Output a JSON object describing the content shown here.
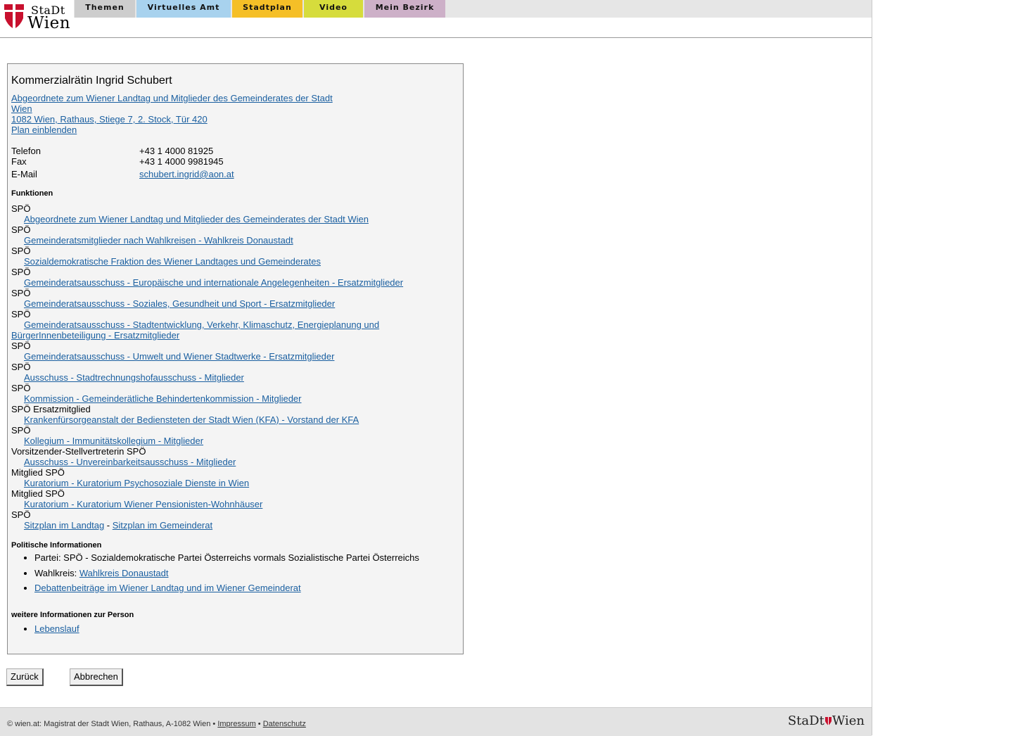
{
  "header": {
    "logo_line1": "StaDt",
    "logo_line2": "Wien",
    "nav": [
      {
        "label": "Themen",
        "color": "#cdcdcd"
      },
      {
        "label": "Virtuelles Amt",
        "color": "#a8d2ee"
      },
      {
        "label": "Stadtplan",
        "color": "#f5bf27"
      },
      {
        "label": "Video",
        "color": "#d6dc3c"
      },
      {
        "label": "Mein Bezirk",
        "color": "#cdb0c8"
      }
    ]
  },
  "person": {
    "name": "Kommerzialrätin Ingrid Schubert",
    "address_line1": "Abgeordnete zum Wiener Landtag und Mitglieder des Gemeinderates der Stadt",
    "address_line2": "Wien ",
    "address_line3": "1082 Wien, Rathaus, Stiege 7, 2. Stock, Tür 420",
    "plan_link": "Plan einblenden",
    "contact": {
      "phone_label": "Telefon",
      "phone": "+43 1 4000 81925",
      "fax_label": "Fax",
      "fax": "+43 1 4000 9981945",
      "email_label": "E-Mail",
      "email": "schubert.ingrid@aon.at"
    }
  },
  "functions": {
    "title": "Funktionen",
    "items": [
      {
        "party": "SPÖ",
        "link": "Abgeordnete zum Wiener Landtag und Mitglieder des Gemeinderates der Stadt Wien"
      },
      {
        "party": "SPÖ",
        "link": "Gemeinderatsmitglieder nach Wahlkreisen - Wahlkreis Donaustadt"
      },
      {
        "party": "SPÖ",
        "link": "Sozialdemokratische Fraktion des Wiener Landtages und Gemeinderates"
      },
      {
        "party": "SPÖ",
        "link": "Gemeinderatsausschuss - Europäische und internationale Angelegenheiten - Ersatzmitglieder"
      },
      {
        "party": "SPÖ",
        "link": "Gemeinderatsausschuss - Soziales, Gesundheit und Sport - Ersatzmitglieder"
      },
      {
        "party": "SPÖ",
        "link": "Gemeinderatsausschuss - Stadtentwicklung, Verkehr, Klimaschutz, Energieplanung und",
        "link_cont": "BürgerInnenbeteiligung - Ersatzmitglieder"
      },
      {
        "party": "SPÖ",
        "link": "Gemeinderatsausschuss - Umwelt und Wiener Stadtwerke - Ersatzmitglieder"
      },
      {
        "party": "SPÖ",
        "link": "Ausschuss - Stadtrechnungshofausschuss - Mitglieder"
      },
      {
        "party": "SPÖ",
        "link": "Kommission - Gemeinderätliche Behindertenkommission - Mitglieder"
      },
      {
        "party": "SPÖ Ersatzmitglied",
        "link": "Krankenfürsorgeanstalt der Bediensteten der Stadt Wien (KFA) - Vorstand der KFA"
      },
      {
        "party": "SPÖ",
        "link": "Kollegium - Immunitätskollegium - Mitglieder"
      },
      {
        "party": "Vorsitzender-Stellvertreterin SPÖ",
        "link": "Ausschuss - Unvereinbarkeitsausschuss - Mitglieder"
      },
      {
        "party": "Mitglied SPÖ",
        "link": "Kuratorium - Kuratorium Psychosoziale Dienste in Wien"
      },
      {
        "party": "Mitglied SPÖ",
        "link": "Kuratorium - Kuratorium Wiener Pensionisten-Wohnhäuser"
      }
    ],
    "last_party": "SPÖ",
    "seat_landtag": "Sitzplan im Landtag",
    "seat_sep": " - ",
    "seat_gemeinderat": "Sitzplan im Gemeinderat"
  },
  "political": {
    "title": "Politische Informationen",
    "party_text": "Partei: SPÖ - Sozialdemokratische Partei Österreichs vormals Sozialistische Partei Österreichs",
    "wahlkreis_label": "Wahlkreis: ",
    "wahlkreis_link": "Wahlkreis Donaustadt",
    "debates_link": "Debattenbeiträge im Wiener Landtag und im Wiener Gemeinderat"
  },
  "more": {
    "title": "weitere Informationen zur Person",
    "cv_link": "Lebenslauf"
  },
  "buttons": {
    "back": "Zurück",
    "cancel": "Abbrechen"
  },
  "footer": {
    "copyright": "© wien.at: Magistrat der Stadt Wien, Rathaus, A-1082 Wien • ",
    "impressum": "Impressum",
    "sep": " • ",
    "datenschutz": "Datenschutz",
    "logo_left": "StaDt",
    "logo_right": "Wien"
  }
}
